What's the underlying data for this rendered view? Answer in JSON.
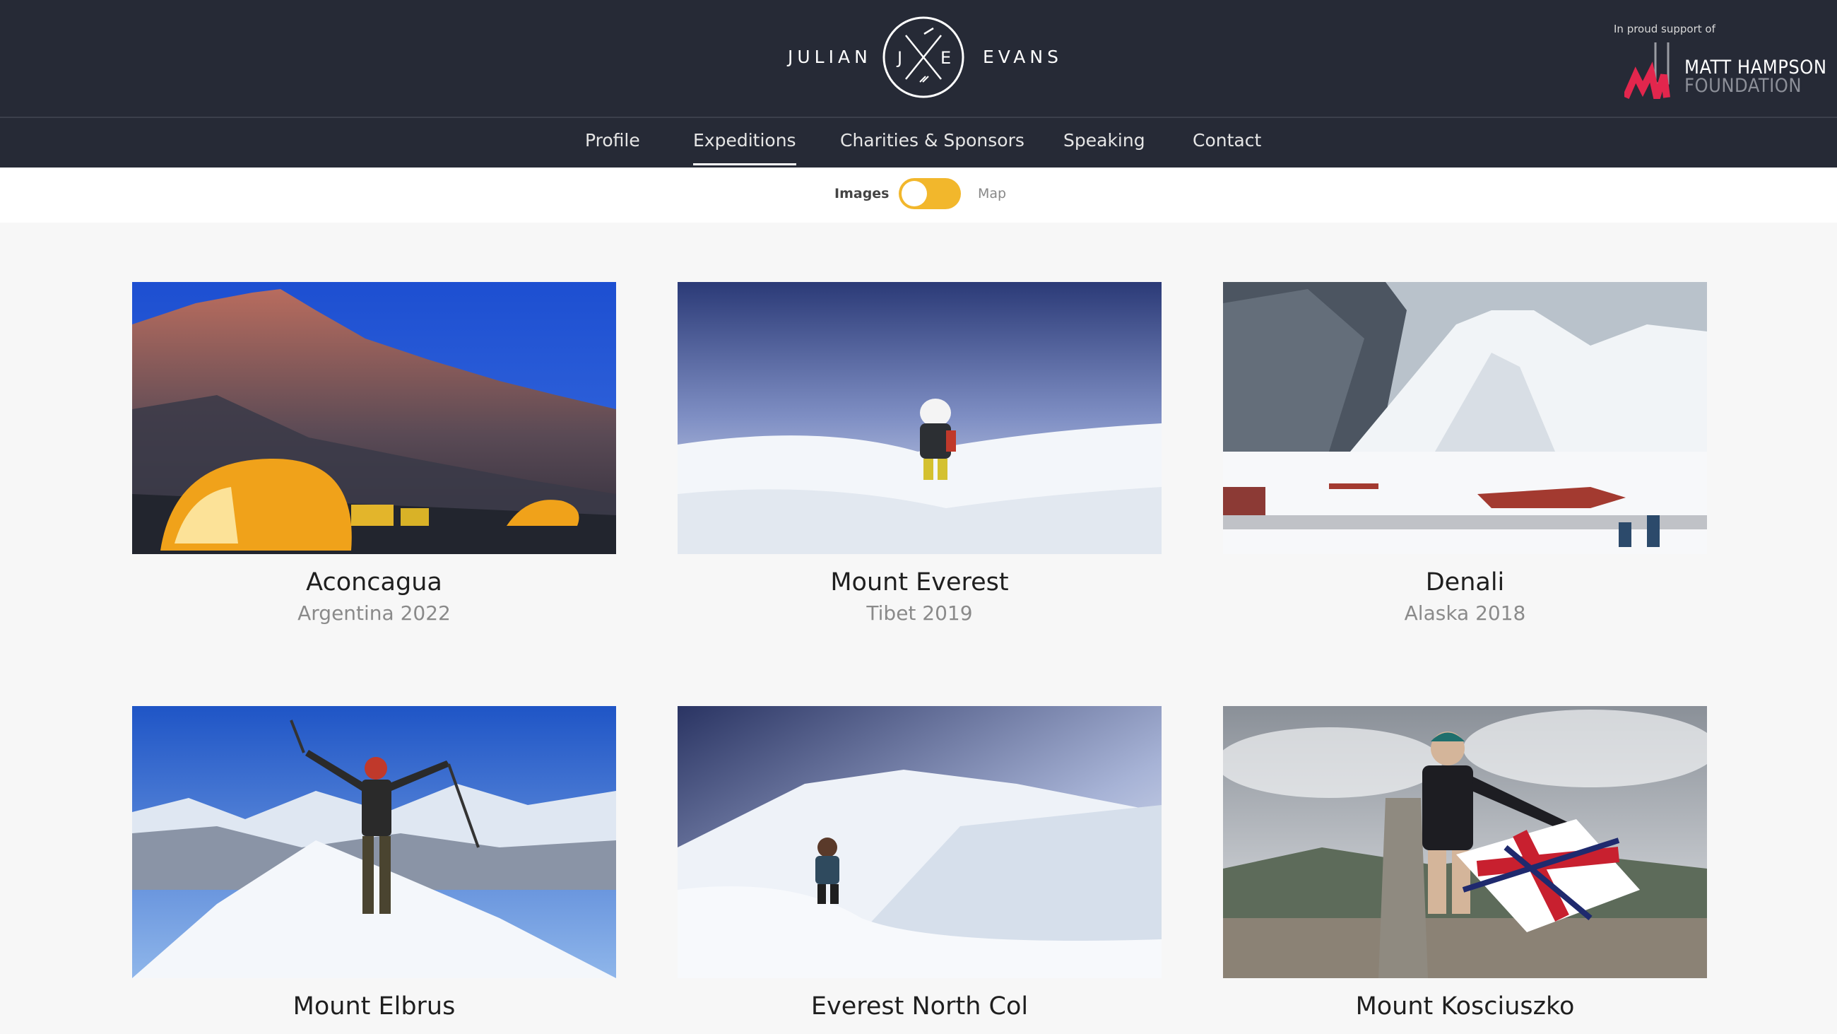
{
  "header": {
    "brand_first": "JULIAN",
    "brand_last": "EVANS",
    "logo_initial_left": "J",
    "logo_initial_right": "E",
    "support_tagline": "In proud support of",
    "support_org_line1": "MATT HAMPSON",
    "support_org_line2": "FOUNDATION",
    "support_logo_icon": "matt-hampson-logo-icon",
    "colors": {
      "background": "#262a36",
      "accent": "#e2264d"
    }
  },
  "nav": {
    "items": [
      {
        "label": "Profile"
      },
      {
        "label": "Expeditions",
        "active": true
      },
      {
        "label": "Charities & Sponsors"
      },
      {
        "label": "Speaking"
      },
      {
        "label": "Contact"
      }
    ]
  },
  "view_toggle": {
    "left_label": "Images",
    "right_label": "Map",
    "selected": "Images",
    "color": "#f2b72c"
  },
  "expeditions": [
    {
      "title": "Aconcagua",
      "subtitle": "Argentina 2022"
    },
    {
      "title": "Mount Everest",
      "subtitle": "Tibet 2019"
    },
    {
      "title": "Denali",
      "subtitle": "Alaska 2018"
    },
    {
      "title": "Mount Elbrus",
      "subtitle": ""
    },
    {
      "title": "Everest North Col",
      "subtitle": ""
    },
    {
      "title": "Mount Kosciuszko",
      "subtitle": ""
    }
  ]
}
